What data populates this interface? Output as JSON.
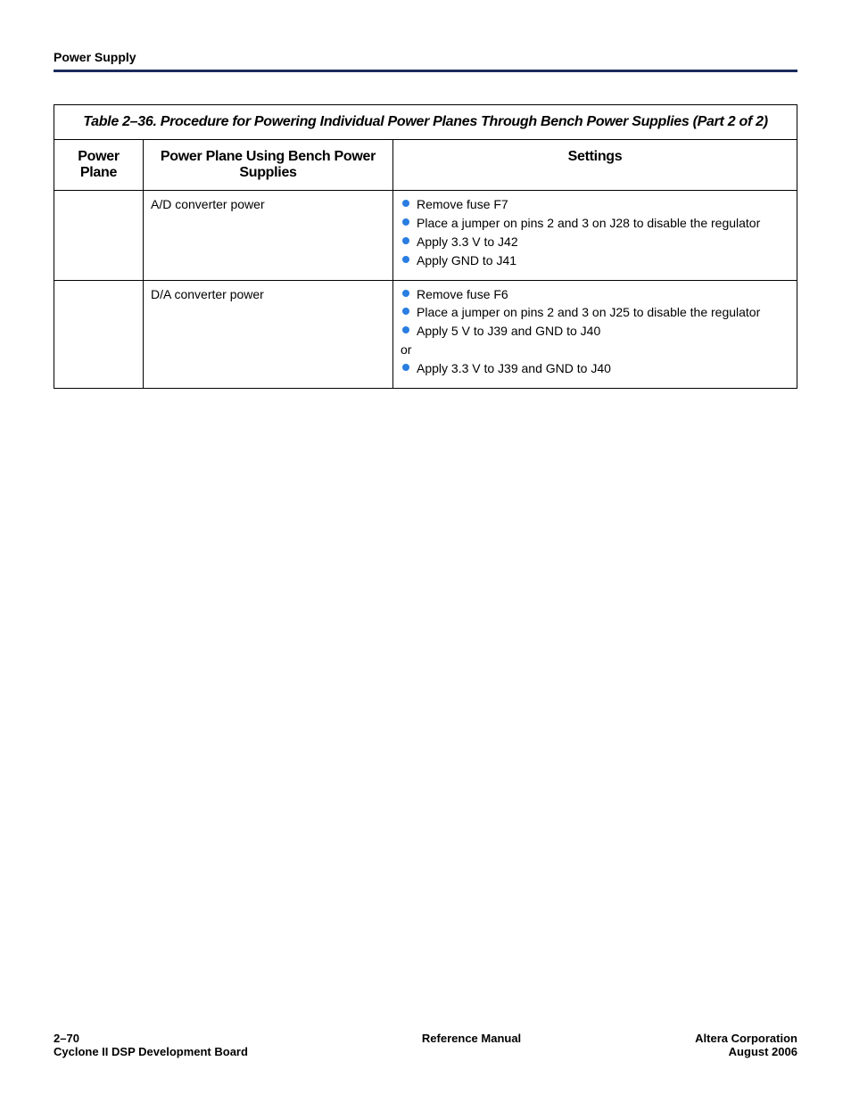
{
  "header": {
    "section": "Power Supply"
  },
  "table": {
    "caption": "Table 2–36. Procedure for Powering Individual Power Planes Through Bench Power Supplies  (Part 2 of 2)",
    "columns": {
      "plane": "Power Plane",
      "supplies": "Power Plane Using Bench Power Supplies",
      "settings": "Settings"
    },
    "rows": [
      {
        "plane": "",
        "supplies": "A/D converter power",
        "settings": {
          "items": [
            "Remove fuse F7",
            "Place a jumper on pins 2 and 3 on J28 to disable the regulator",
            "Apply 3.3 V to J42",
            "Apply GND to J41"
          ],
          "or": null,
          "or_items": []
        }
      },
      {
        "plane": "",
        "supplies": "D/A converter power",
        "settings": {
          "items": [
            "Remove fuse F6",
            "Place a jumper on pins 2 and 3 on J25 to disable the regulator",
            "Apply 5 V to J39 and GND to J40"
          ],
          "or": "or",
          "or_items": [
            "Apply 3.3 V to J39 and GND to J40"
          ]
        }
      }
    ]
  },
  "footer": {
    "page_num": "2–70",
    "board": "Cyclone II DSP Development Board",
    "center": "Reference Manual",
    "corp": "Altera Corporation",
    "date": "August 2006"
  }
}
